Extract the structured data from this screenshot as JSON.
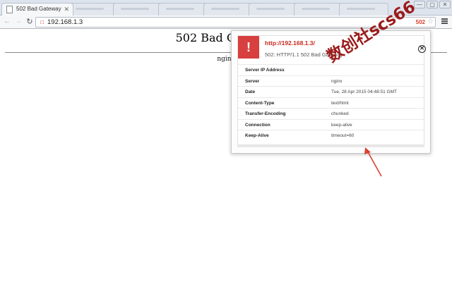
{
  "tabs": [
    {
      "title": "502 Bad Gateway",
      "active": true
    }
  ],
  "window_controls": {
    "minimize": "—",
    "maximize": "▢",
    "close": "✕"
  },
  "toolbar": {
    "url": "192.168.1.3",
    "status_code": "502",
    "back_icon": "back-arrow-icon",
    "forward_icon": "forward-arrow-icon",
    "reload_icon": "reload-icon"
  },
  "page": {
    "heading": "502 Bad Gateway",
    "footer": "nginx"
  },
  "popup": {
    "url": "http://192.168.1.3/",
    "status": "502: HTTP/1.1 502 Bad Gateway",
    "alert_symbol": "!",
    "close_symbol": "✕",
    "headers": [
      {
        "key": "Server IP Address",
        "value": ""
      },
      {
        "key": "Server",
        "value": "nginx"
      },
      {
        "key": "Date",
        "value": "Tue, 28 Apr 2015 04:48:51 GMT"
      },
      {
        "key": "Content-Type",
        "value": "text/html"
      },
      {
        "key": "Transfer-Encoding",
        "value": "chunked"
      },
      {
        "key": "Connection",
        "value": "keep-alive"
      },
      {
        "key": "Keep-Alive",
        "value": "timeout=60"
      }
    ]
  },
  "watermark": "数创社scs66",
  "colors": {
    "accent_red": "#d83f3f",
    "url_red": "#c8281e",
    "watermark": "#9b1a1a"
  }
}
